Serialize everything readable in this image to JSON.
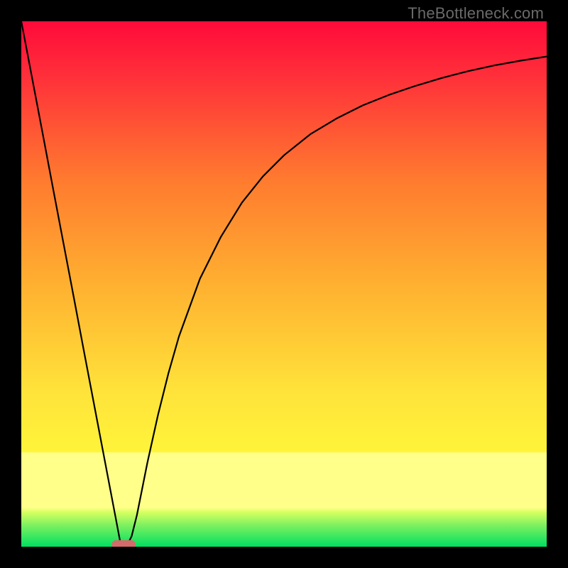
{
  "watermark": "TheBottleneck.com",
  "chart_data": {
    "type": "line",
    "title": "",
    "xlabel": "",
    "ylabel": "",
    "xlim": [
      0,
      100
    ],
    "ylim": [
      0,
      100
    ],
    "grid": false,
    "background_gradient": {
      "top_color": "#ff0a3a",
      "mid_color_1": "#ff8a2a",
      "mid_color_2": "#ffe53a",
      "band_color": "#ffff8a",
      "bottom_color": "#00e060"
    },
    "series": [
      {
        "name": "curve",
        "color": "#000000",
        "x": [
          0,
          2,
          4,
          6,
          8,
          10,
          12,
          14,
          16,
          18,
          19,
          20,
          21,
          22,
          24,
          26,
          28,
          30,
          34,
          38,
          42,
          46,
          50,
          55,
          60,
          65,
          70,
          75,
          80,
          85,
          90,
          95,
          100
        ],
        "y": [
          100,
          89.5,
          79,
          68.4,
          57.9,
          47.4,
          36.8,
          26.3,
          15.8,
          5.3,
          0,
          0,
          2,
          6,
          16,
          25,
          33,
          40,
          51,
          59,
          65.5,
          70.5,
          74.5,
          78.5,
          81.5,
          84,
          86,
          87.7,
          89.2,
          90.5,
          91.6,
          92.5,
          93.3
        ]
      }
    ],
    "marker": {
      "name": "bottleneck-marker",
      "shape": "rounded-rect",
      "color": "#d46a6a",
      "x_center": 19.5,
      "y_center": 0,
      "width": 4.5,
      "height": 2.5
    }
  }
}
